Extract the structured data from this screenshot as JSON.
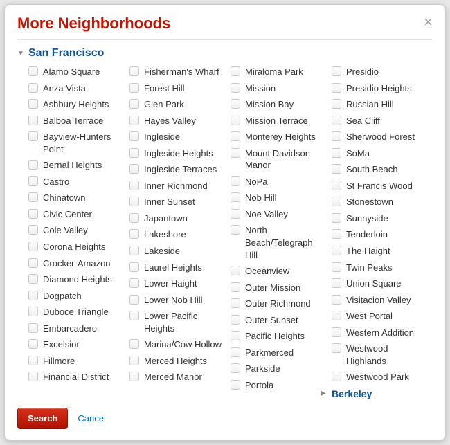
{
  "modal": {
    "title": "More Neighborhoods"
  },
  "city_expanded": {
    "name": "San Francisco",
    "columns": [
      [
        "Alamo Square",
        "Anza Vista",
        "Ashbury Heights",
        "Balboa Terrace",
        "Bayview-Hunters Point",
        "Bernal Heights",
        "Castro",
        "Chinatown",
        "Civic Center",
        "Cole Valley",
        "Corona Heights",
        "Crocker-Amazon",
        "Diamond Heights",
        "Dogpatch",
        "Duboce Triangle",
        "Embarcadero",
        "Excelsior",
        "Fillmore",
        "Financial District"
      ],
      [
        "Fisherman's Wharf",
        "Forest Hill",
        "Glen Park",
        "Hayes Valley",
        "Ingleside",
        "Ingleside Heights",
        "Ingleside Terraces",
        "Inner Richmond",
        "Inner Sunset",
        "Japantown",
        "Lakeshore",
        "Lakeside",
        "Laurel Heights",
        "Lower Haight",
        "Lower Nob Hill",
        "Lower Pacific Heights",
        "Marina/Cow Hollow",
        "Merced Heights",
        "Merced Manor"
      ],
      [
        "Miraloma Park",
        "Mission",
        "Mission Bay",
        "Mission Terrace",
        "Monterey Heights",
        "Mount Davidson Manor",
        "NoPa",
        "Nob Hill",
        "Noe Valley",
        "North Beach/Telegraph Hill",
        "Oceanview",
        "Outer Mission",
        "Outer Richmond",
        "Outer Sunset",
        "Pacific Heights",
        "Parkmerced",
        "Parkside",
        "Portola"
      ],
      [
        "Presidio",
        "Presidio Heights",
        "Russian Hill",
        "Sea Cliff",
        "Sherwood Forest",
        "SoMa",
        "South Beach",
        "St Francis Wood",
        "Stonestown",
        "Sunnyside",
        "Tenderloin",
        "The Haight",
        "Twin Peaks",
        "Union Square",
        "Visitacion Valley",
        "West Portal",
        "Western Addition",
        "Westwood Highlands",
        "Westwood Park"
      ]
    ]
  },
  "city_collapsed": {
    "name": "Berkeley"
  },
  "footer": {
    "search_label": "Search",
    "cancel_label": "Cancel"
  }
}
